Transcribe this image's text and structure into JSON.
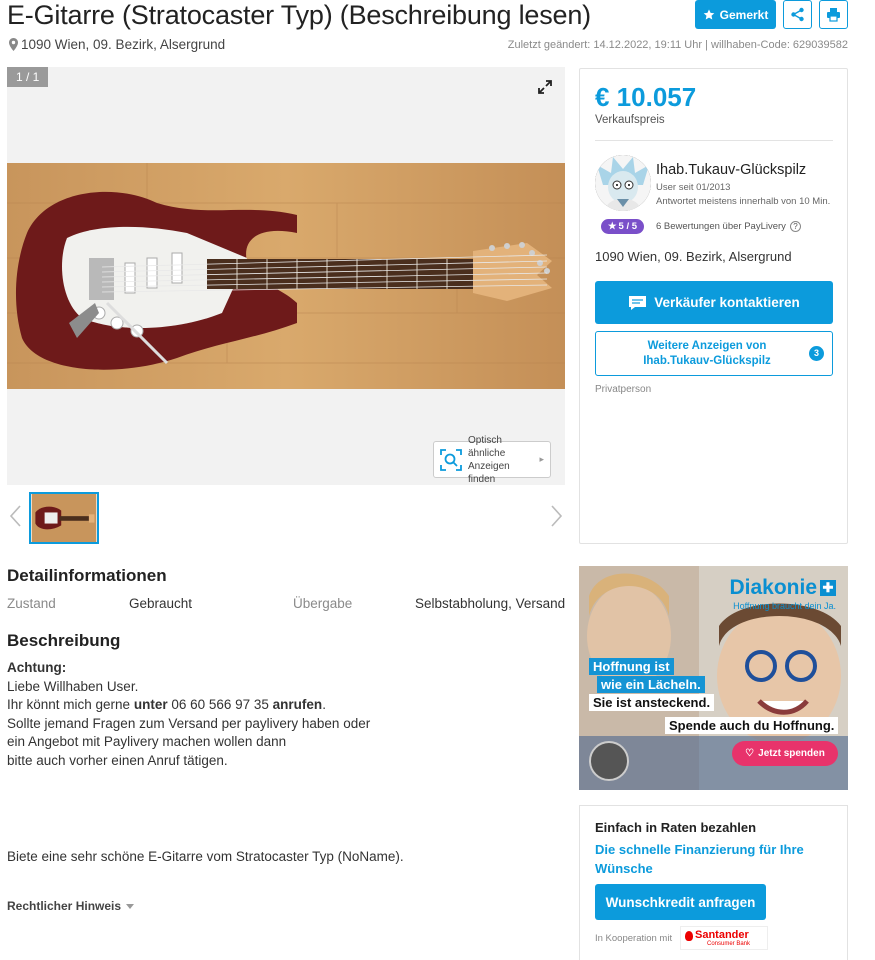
{
  "listing": {
    "title": "E-Gitarre (Stratocaster Typ) (Beschreibung lesen)",
    "location": "1090 Wien, 09. Bezirk, Alsergrund",
    "meta": "Zuletzt geändert: 14.12.2022, 19:11 Uhr | willhaben-Code: 629039582"
  },
  "toolbar": {
    "gemerkt_label": "Gemerkt",
    "share_icon": "share-icon",
    "print_icon": "print-icon"
  },
  "gallery": {
    "counter": "1 / 1",
    "similar_line1": "Optisch ähnliche",
    "similar_line2": "Anzeigen finden"
  },
  "details": {
    "heading": "Detailinformationen",
    "zustand_label": "Zustand",
    "zustand_value": "Gebraucht",
    "uebergabe_label": "Übergabe",
    "uebergabe_value": "Selbstabholung, Versand"
  },
  "description": {
    "heading": "Beschreibung",
    "achtung": "Achtung:",
    "line1": "Liebe Willhaben User.",
    "line2_a": "Ihr könnt mich gerne ",
    "line2_b": "unter",
    "line2_c": " 06 60 566 97 35 ",
    "line2_d": "anrufen",
    "line2_e": ".",
    "line3": "Sollte jemand Fragen zum Versand per paylivery haben oder",
    "line4": "ein Angebot mit Paylivery machen wollen dann",
    "line5": "bitte auch vorher einen Anruf tätigen.",
    "extra": "Biete eine sehr schöne E-Gitarre vom Stratocaster Typ (NoName).",
    "legal": "Rechtlicher Hinweis"
  },
  "seller": {
    "price": "€ 10.057",
    "price_label": "Verkaufspreis",
    "name": "Ihab.Tukauv-Glückspilz",
    "since": "User seit 01/2013",
    "response": "Antwortet meistens innerhalb von 10 Min.",
    "rating": "5 / 5",
    "ratings_text": "6 Bewertungen über PayLivery",
    "location": "1090 Wien, 09. Bezirk, Alsergrund",
    "contact_label": "Verkäufer kontaktieren",
    "more_label": "Weitere Anzeigen von Ihab.Tukauv-Glückspilz",
    "more_count": "3",
    "type": "Privatperson"
  },
  "ad": {
    "brand": "Diakonie",
    "tagline": "Hoffnung braucht dein Ja.",
    "line1": "Hoffnung ist",
    "line2": "wie ein Lächeln.",
    "line3": "Sie ist ansteckend.",
    "line4": "Spende auch du Hoffnung.",
    "button": "Jetzt spenden"
  },
  "loan": {
    "title": "Einfach in Raten bezahlen",
    "subtitle": "Die schnelle Finanzierung für Ihre Wünsche",
    "button": "Wunschkredit anfragen",
    "koop": "In Kooperation mit",
    "partner": "Santander",
    "partner_sub": "Consumer Bank"
  },
  "colors": {
    "accent": "#0c9bdc",
    "rating_badge": "#7a4fc9"
  }
}
